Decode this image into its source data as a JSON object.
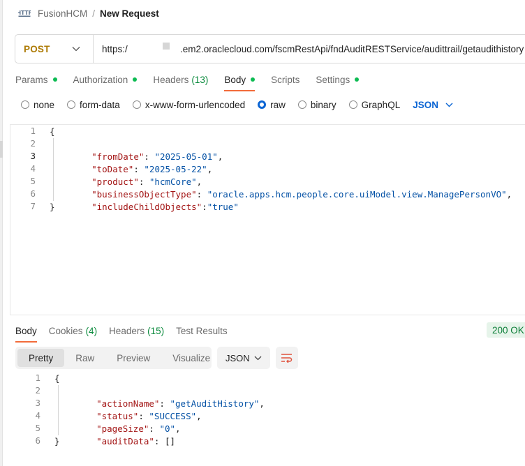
{
  "breadcrumb": {
    "parent": "FusionHCM",
    "separator": "/",
    "current": "New Request",
    "icon": "http-icon"
  },
  "request": {
    "method": "POST",
    "url_prefix": "https:/",
    "url_rest": ".em2.oraclecloud.com/fscmRestApi/fndAuditRESTService/audittrail/getaudithistory"
  },
  "request_tabs": [
    {
      "label": "Params",
      "dot": true
    },
    {
      "label": "Authorization",
      "dot": true
    },
    {
      "label": "Headers",
      "count": "(13)"
    },
    {
      "label": "Body",
      "dot": true,
      "active": true
    },
    {
      "label": "Scripts"
    },
    {
      "label": "Settings",
      "dot": true
    }
  ],
  "body_options": {
    "items": [
      "none",
      "form-data",
      "x-www-form-urlencoded",
      "raw",
      "binary",
      "GraphQL"
    ],
    "selected": "raw",
    "format": "JSON"
  },
  "request_body": {
    "line_numbers": [
      "1",
      "2",
      "3",
      "4",
      "5",
      "6",
      "7"
    ],
    "open": "{",
    "fields": [
      {
        "key": "\"fromDate\"",
        "value": "\"2025-05-01\"",
        "sep": ": ",
        "trail": ","
      },
      {
        "key": "\"toDate\"",
        "value": "\"2025-05-22\"",
        "sep": ": ",
        "trail": ","
      },
      {
        "key": "\"product\"",
        "value": "\"hcmCore\"",
        "sep": ": ",
        "trail": ","
      },
      {
        "key": "\"businessObjectType\"",
        "value": "\"oracle.apps.hcm.people.core.uiModel.view.ManagePersonVO\"",
        "sep": ": ",
        "trail": ","
      },
      {
        "key": "\"includeChildObjects\"",
        "value": "\"true\"",
        "sep": ":",
        "trail": ""
      }
    ],
    "close": "}"
  },
  "response_tabs": [
    {
      "label": "Body",
      "active": true
    },
    {
      "label": "Cookies",
      "count": "(4)"
    },
    {
      "label": "Headers",
      "count": "(15)"
    },
    {
      "label": "Test Results"
    }
  ],
  "status": "200 OK",
  "view_modes": [
    "Pretty",
    "Raw",
    "Preview",
    "Visualize"
  ],
  "view_selected": "Pretty",
  "response_format": "JSON",
  "response_body": {
    "line_numbers": [
      "1",
      "2",
      "3",
      "4",
      "5",
      "6"
    ],
    "open": "{",
    "fields": [
      {
        "key": "\"actionName\"",
        "value": "\"getAuditHistory\"",
        "trail": ","
      },
      {
        "key": "\"status\"",
        "value": "\"SUCCESS\"",
        "trail": ","
      },
      {
        "key": "\"pageSize\"",
        "value": "\"0\"",
        "trail": ","
      },
      {
        "key": "\"auditData\"",
        "value": "[]",
        "trail": ""
      }
    ],
    "close": "}"
  },
  "colors": {
    "accent": "#f26b3a",
    "method": "#ad7a03",
    "link_blue": "#0b65d4",
    "dot_green": "#0cbb52",
    "json_key": "#a31515",
    "json_string": "#0451a5"
  }
}
